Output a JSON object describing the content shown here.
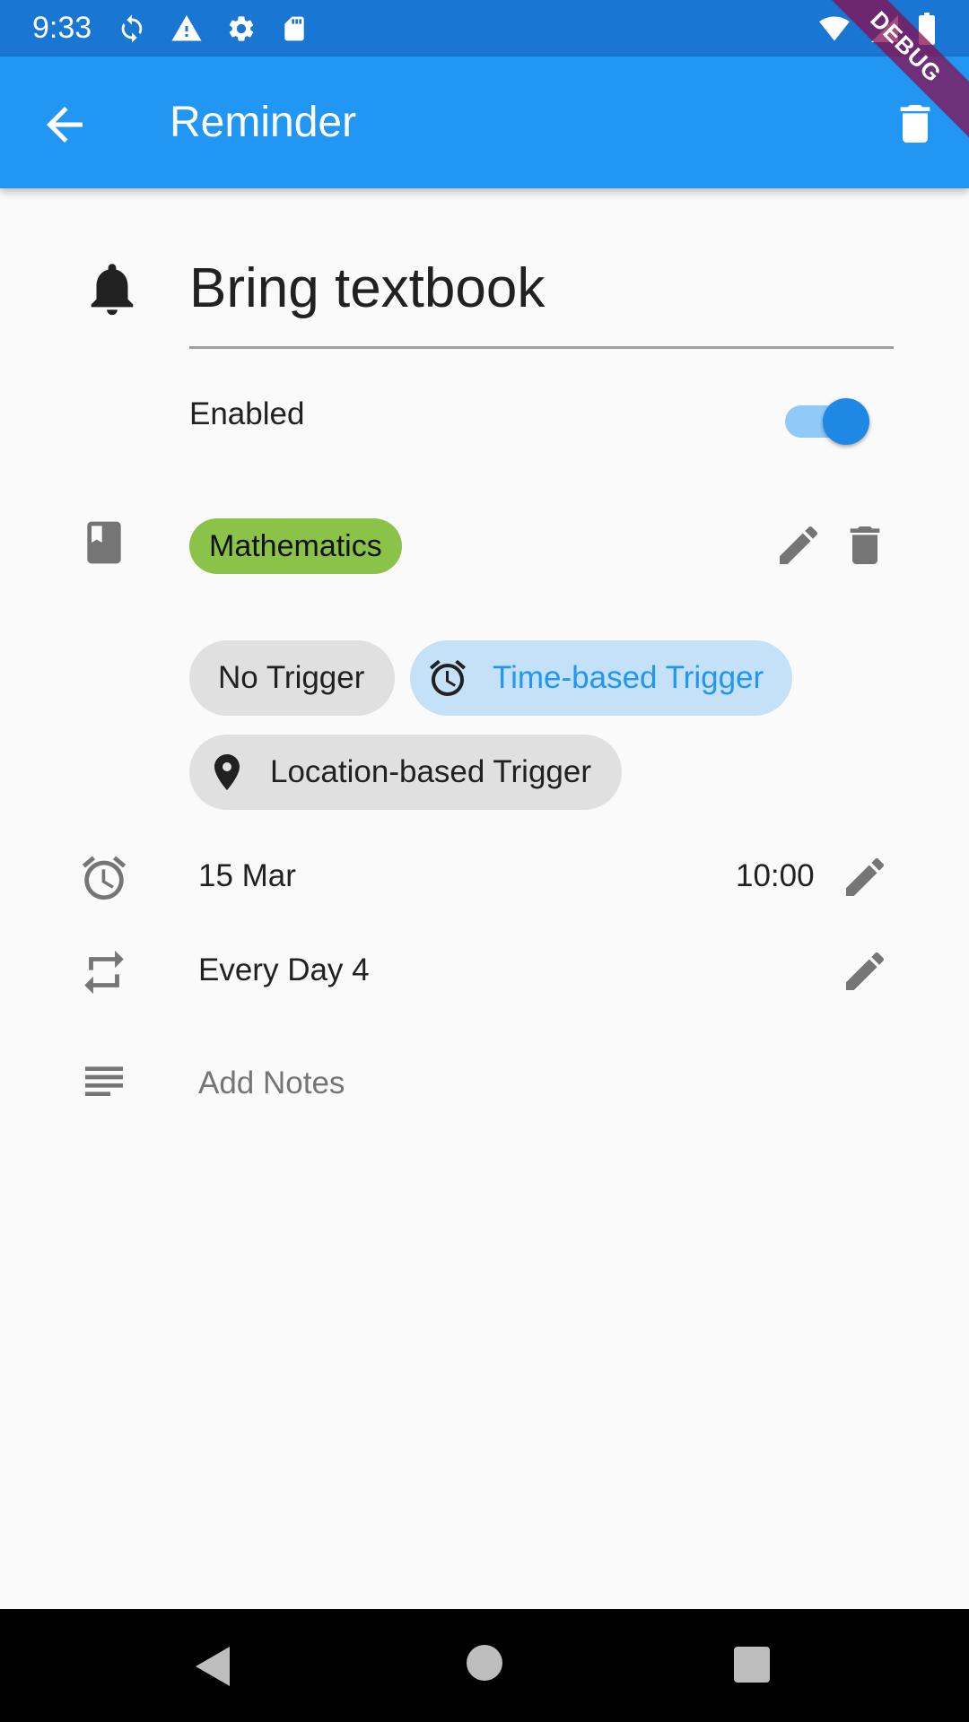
{
  "status_bar": {
    "time": "9:33",
    "icons": [
      "sync-icon",
      "warning-icon",
      "settings-icon",
      "sd-card-icon"
    ],
    "right_icons": [
      "wifi-icon",
      "signal-icon",
      "battery-icon"
    ]
  },
  "debug_banner": "DEBUG",
  "app_bar": {
    "title": "Reminder",
    "back_icon": "arrow-back-icon",
    "delete_icon": "delete-icon",
    "color": "#2196f3"
  },
  "reminder": {
    "title": "Bring textbook",
    "enabled_label": "Enabled",
    "enabled": true
  },
  "subject": {
    "name": "Mathematics",
    "color": "#8bc34a"
  },
  "triggers": [
    {
      "label": "No Trigger",
      "selected": false
    },
    {
      "label": "Time-based Trigger",
      "icon": "alarm-icon",
      "selected": true
    },
    {
      "label": "Location-based Trigger",
      "icon": "location-pin-icon",
      "selected": false
    }
  ],
  "schedule": {
    "date": "15 Mar",
    "time": "10:00",
    "repeat": "Every Day 4"
  },
  "notes": {
    "placeholder": "Add Notes"
  },
  "nav_bar": {
    "icons": [
      "back-triangle-icon",
      "home-circle-icon",
      "recents-square-icon"
    ]
  }
}
